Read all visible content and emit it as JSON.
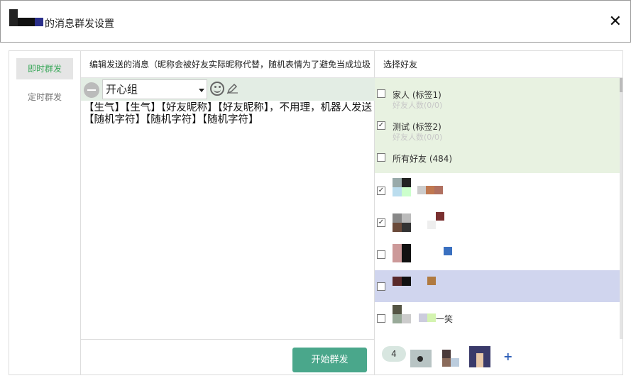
{
  "window": {
    "title": "的消息群发设置",
    "close_symbol": "✕"
  },
  "nav": {
    "items": [
      {
        "label": "即时群发",
        "active": true
      },
      {
        "label": "定时群发",
        "active": false
      }
    ]
  },
  "editor": {
    "header": "编辑发送的消息（昵称会被好友实际昵称代替，随机表情为了避免当成垃圾",
    "group_selected": "开心组",
    "message": "【生气】【生气】【好友昵称】【好友昵称】，不用理，机器人发送【随机字符】【随机字符】【随机字符】",
    "send_button": "开始群发",
    "emoji_icon": "smiley-icon",
    "pen_icon": "pen-icon"
  },
  "friends": {
    "header": "选择好友",
    "groups": [
      {
        "name": "家人 (标签1)",
        "count": "好友人数(0/0)",
        "checked": false
      },
      {
        "name": "测试 (标签2)",
        "count": "好友人数(0/0)",
        "checked": true
      },
      {
        "name": "所有好友 (484)",
        "count": "",
        "checked": false
      }
    ],
    "contacts": [
      {
        "name": "",
        "checked": true
      },
      {
        "name": "",
        "checked": true
      },
      {
        "name": "",
        "checked": false
      },
      {
        "name": "",
        "checked": false,
        "highlighted": true
      },
      {
        "name": "一笑",
        "checked": false
      }
    ],
    "selected_count": "4",
    "add_symbol": "+"
  },
  "colors": {
    "accent_green": "#3aa85a",
    "button": "#4aa78b",
    "group_bg": "#e8f2e1",
    "highlight_row": "#d0d5ee"
  }
}
